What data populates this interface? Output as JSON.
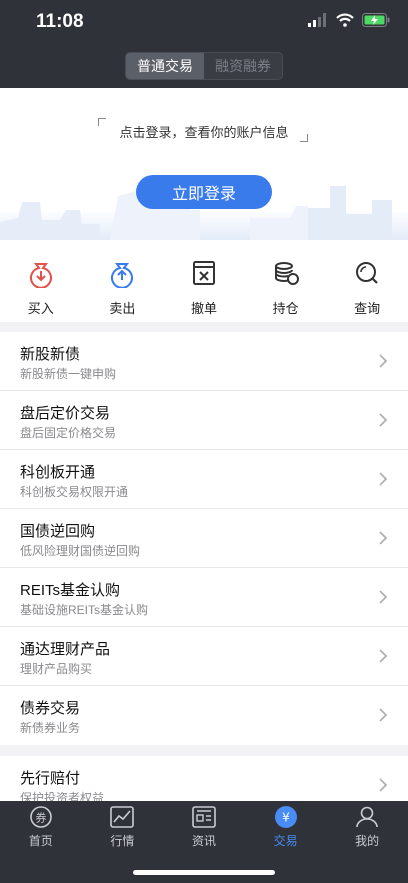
{
  "status": {
    "time": "11:08"
  },
  "header": {
    "segments": [
      {
        "label": "普通交易",
        "active": true
      },
      {
        "label": "融资融券",
        "active": false
      }
    ]
  },
  "hero": {
    "prompt": "点击登录，查看你的账户信息",
    "login_label": "立即登录"
  },
  "actions": [
    {
      "label": "买入",
      "icon": "buy-icon"
    },
    {
      "label": "卖出",
      "icon": "sell-icon"
    },
    {
      "label": "撤单",
      "icon": "cancel-order-icon"
    },
    {
      "label": "持仓",
      "icon": "positions-icon"
    },
    {
      "label": "查询",
      "icon": "search-icon"
    }
  ],
  "menu": [
    {
      "title": "新股新债",
      "subtitle": "新股新债一键申购"
    },
    {
      "title": "盘后定价交易",
      "subtitle": "盘后固定价格交易"
    },
    {
      "title": "科创板开通",
      "subtitle": "科创板交易权限开通"
    },
    {
      "title": "国债逆回购",
      "subtitle": "低风险理财国债逆回购"
    },
    {
      "title": "REITs基金认购",
      "subtitle": "基础设施REITs基金认购"
    },
    {
      "title": "通达理财产品",
      "subtitle": "理财产品购买"
    },
    {
      "title": "债券交易",
      "subtitle": "新债券业务"
    }
  ],
  "menu2": [
    {
      "title": "先行赔付",
      "subtitle": "保护投资者权益"
    }
  ],
  "tabbar": {
    "items": [
      {
        "label": "首页",
        "icon": "home-icon",
        "active": false
      },
      {
        "label": "行情",
        "icon": "market-icon",
        "active": false
      },
      {
        "label": "资讯",
        "icon": "news-icon",
        "active": false
      },
      {
        "label": "交易",
        "icon": "trade-icon",
        "active": true
      },
      {
        "label": "我的",
        "icon": "profile-icon",
        "active": false
      }
    ]
  },
  "colors": {
    "accent": "#3a7bec",
    "sell": "#3a7bec",
    "buy": "#e0524a",
    "dark": "#2f3238"
  }
}
